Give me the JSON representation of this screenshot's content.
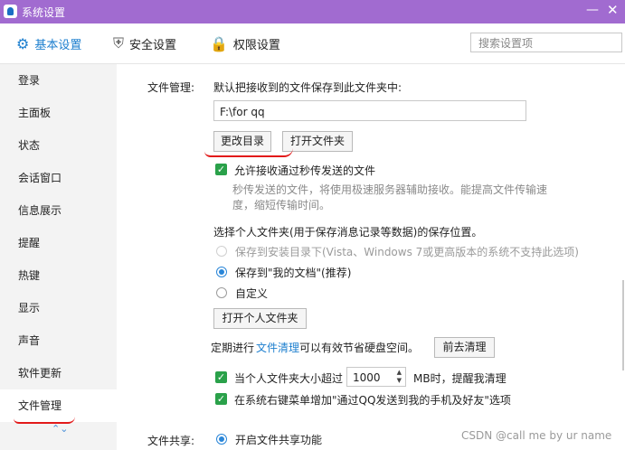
{
  "window": {
    "title": "系统设置",
    "minimize": "—",
    "close": "✕"
  },
  "tabs": [
    {
      "label": "基本设置",
      "icon": "⚙"
    },
    {
      "label": "安全设置",
      "icon": "⛨"
    },
    {
      "label": "权限设置",
      "icon": "🔒"
    }
  ],
  "search": {
    "placeholder": "搜索设置项"
  },
  "sidebar": {
    "items": [
      "登录",
      "主面板",
      "状态",
      "会话窗口",
      "信息展示",
      "提醒",
      "热键",
      "显示",
      "声音",
      "软件更新",
      "文件管理"
    ],
    "active": "文件管理",
    "scroll_icons": "⌃⌄"
  },
  "file_management": {
    "section_label": "文件管理:",
    "save_folder_text": "默认把接收到的文件保存到此文件夹中:",
    "path_value": "F:\\for qq",
    "change_dir_button": "更改目录",
    "open_folder_button": "打开文件夹",
    "instant_send_checkbox": "允许接收通过秒传发送的文件",
    "instant_send_desc_line1": "秒传发送的文件，将使用极速服务器辅助接收。能提高文件传输速",
    "instant_send_desc_line2": "度，缩短传输时间。",
    "personal_folder_title": "选择个人文件夹(用于保存消息记录等数据)的保存位置。",
    "radio_install_dir": "保存到安装目录下(Vista、Windows 7或更高版本的系统不支持此选项)",
    "radio_my_documents": "保存到\"我的文档\"(推荐)",
    "radio_custom": "自定义",
    "open_personal_folder_button": "打开个人文件夹",
    "cleanup_prefix": "定期进行",
    "cleanup_link": "文件清理",
    "cleanup_suffix": "可以有效节省硬盘空间。",
    "go_cleanup_button": "前去清理",
    "size_limit_prefix": "当个人文件夹大小超过",
    "size_limit_value": "1000",
    "size_limit_suffix": "MB时，提醒我清理",
    "context_menu_checkbox": "在系统右键菜单增加\"通过QQ发送到我的手机及好友\"选项"
  },
  "file_sharing": {
    "section_label": "文件共享:",
    "enable_sharing": "开启文件共享功能"
  },
  "watermark": "CSDN @call me by ur name",
  "colors": {
    "title_bar": "#a16bd0",
    "accent": "#1d7fcf",
    "checkbox": "#2aa14a",
    "annotation": "#e21a1a"
  }
}
